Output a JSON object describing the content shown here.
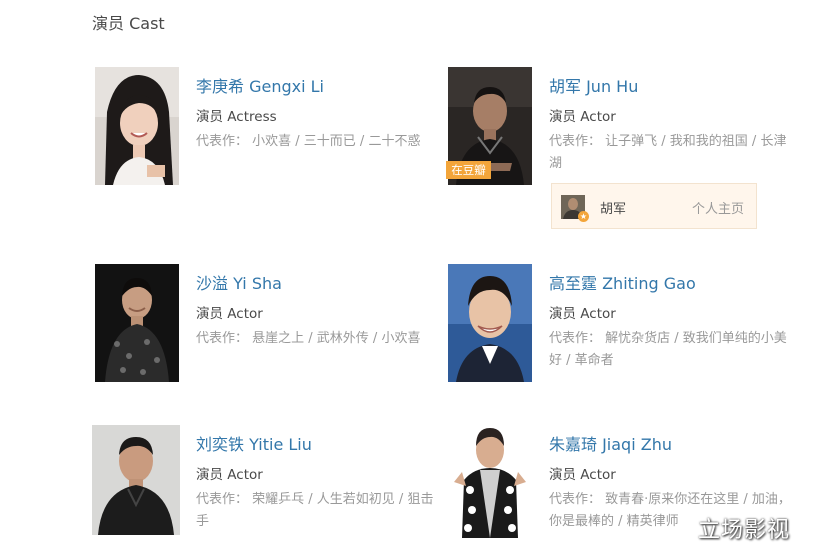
{
  "section": {
    "title": "演员 Cast"
  },
  "cast": [
    {
      "name": "李庚希 Gengxi Li",
      "role": "演员 Actress",
      "works_label": "代表作：",
      "works": "小欢喜 / 三十而已 / 二十不惑"
    },
    {
      "name": "胡军 Jun Hu",
      "role": "演员 Actor",
      "works_label": "代表作：",
      "works": "让子弹飞 / 我和我的祖国 / 长津湖",
      "tag": "在豆瓣",
      "profile": {
        "name": "胡军",
        "link": "个人主页"
      }
    },
    {
      "name": "沙溢 Yi Sha",
      "role": "演员 Actor",
      "works_label": "代表作：",
      "works": "悬崖之上 / 武林外传 / 小欢喜"
    },
    {
      "name": "高至霆 Zhiting Gao",
      "role": "演员 Actor",
      "works_label": "代表作：",
      "works": "解忧杂货店 / 致我们单纯的小美好 / 革命者"
    },
    {
      "name": "刘奕铁 Yitie Liu",
      "role": "演员 Actor",
      "works_label": "代表作：",
      "works": "荣耀乒乓 / 人生若如初见 / 狙击手"
    },
    {
      "name": "朱嘉琦 Jiaqi Zhu",
      "role": "演员 Actor",
      "works_label": "代表作：",
      "works": "致青春·原来你还在这里 / 加油，你是最棒的 / 精英律师"
    }
  ],
  "watermark": "立场影视"
}
